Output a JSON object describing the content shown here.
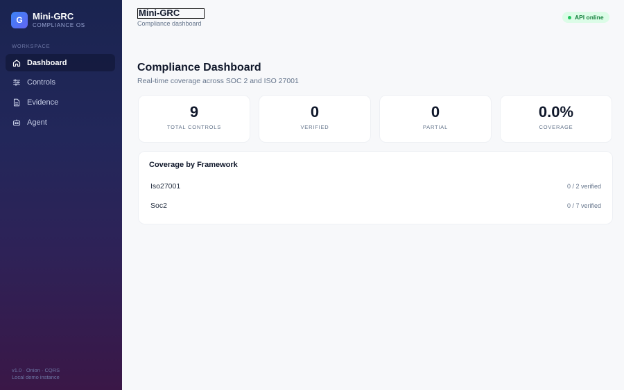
{
  "brand": {
    "logo_letter": "G",
    "name": "Mini-GRC",
    "subtitle": "COMPLIANCE OS"
  },
  "sidebar": {
    "section_label": "WORKSPACE",
    "items": [
      {
        "label": "Dashboard",
        "icon": "home-icon",
        "active": true
      },
      {
        "label": "Controls",
        "icon": "sliders-icon",
        "active": false
      },
      {
        "label": "Evidence",
        "icon": "document-icon",
        "active": false
      },
      {
        "label": "Agent",
        "icon": "robot-icon",
        "active": false
      }
    ],
    "footer_line1": "v1.0 · Onion · CQRS",
    "footer_line2": "Local demo instance"
  },
  "header": {
    "title": "Mini-GRC",
    "subtitle": "Compliance dashboard",
    "status": "API online",
    "status_color": "#22c55e"
  },
  "main": {
    "title": "Compliance Dashboard",
    "subtitle": "Real-time coverage across SOC 2 and ISO 27001",
    "stats": [
      {
        "value": "9",
        "label": "TOTAL CONTROLS"
      },
      {
        "value": "0",
        "label": "VERIFIED"
      },
      {
        "value": "0",
        "label": "PARTIAL"
      },
      {
        "value": "0.0%",
        "label": "COVERAGE"
      }
    ],
    "frameworks": {
      "title": "Coverage by Framework",
      "rows": [
        {
          "name": "Iso27001",
          "count": "0 / 2 verified"
        },
        {
          "name": "Soc2",
          "count": "0 / 7 verified"
        }
      ]
    }
  },
  "colors": {
    "accent": "#3b82f6",
    "sidebar_top": "#1a2450",
    "sidebar_bottom": "#3a1747"
  }
}
